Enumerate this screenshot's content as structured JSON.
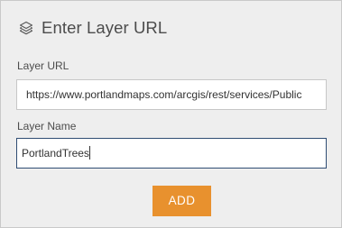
{
  "panel": {
    "title": "Enter Layer URL",
    "icon": "layers-icon"
  },
  "fields": {
    "url_label": "Layer URL",
    "url_value": "https://www.portlandmaps.com/arcgis/rest/services/Public",
    "name_label": "Layer Name",
    "name_value": "PortlandTrees"
  },
  "actions": {
    "add_label": "ADD"
  },
  "colors": {
    "panel_bg": "#eeeeee",
    "accent_button": "#e8912e",
    "focus_border": "#2f4d73",
    "text": "#4c4c4c"
  }
}
